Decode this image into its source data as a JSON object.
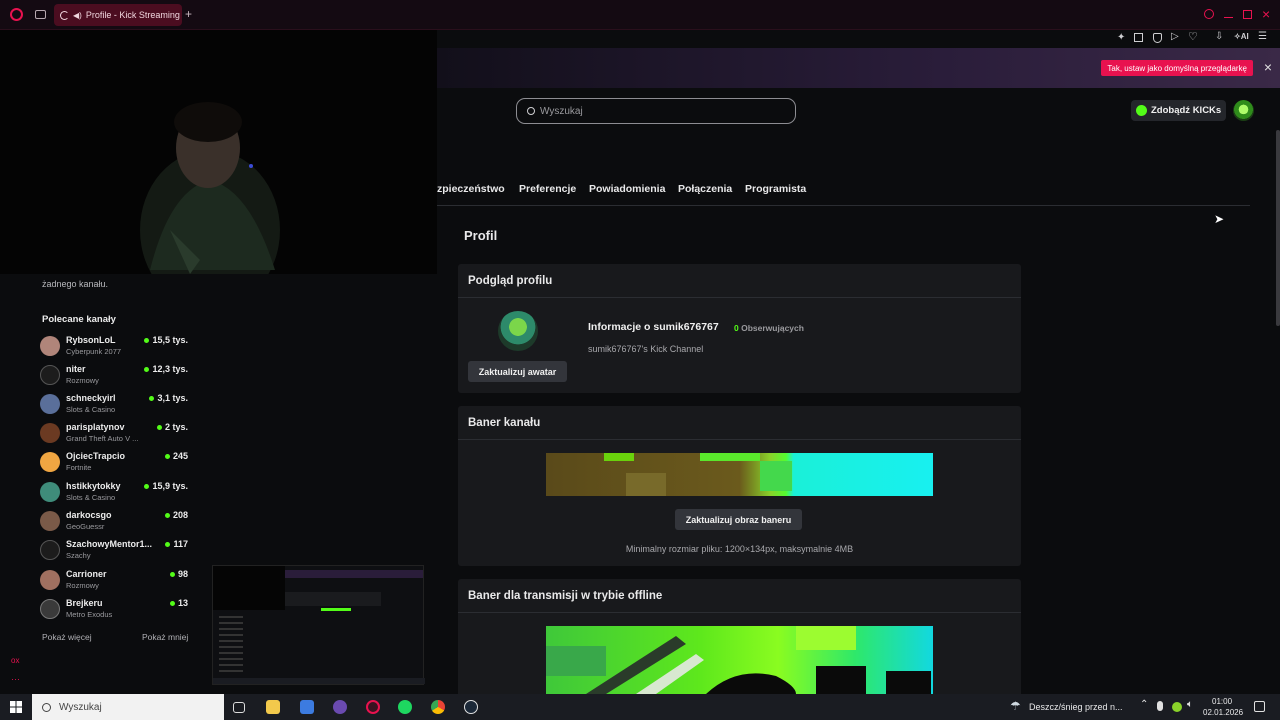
{
  "browser": {
    "tab_title": "Profile - Kick Streaming",
    "new_tab": "+",
    "default_browser_prompt": "Tak, ustaw jako domyślną przeglądarkę",
    "close": "×",
    "ai_label": "AI"
  },
  "sidebar": {
    "no_channel_text": "żadnego kanału.",
    "recommended_title": "Polecane kanały",
    "channels": [
      {
        "name": "RybsonLoL",
        "category": "Cyberpunk 2077",
        "viewers": "15,5 tys."
      },
      {
        "name": "niter",
        "category": "Rozmowy",
        "viewers": "12,3 tys."
      },
      {
        "name": "schneckyirl",
        "category": "Slots & Casino",
        "viewers": "3,1 tys."
      },
      {
        "name": "parisplatynov",
        "category": "Grand Theft Auto V ...",
        "viewers": "2 tys."
      },
      {
        "name": "OjciecTrapcio",
        "category": "Fortnite",
        "viewers": "245"
      },
      {
        "name": "hstikkytokky",
        "category": "Slots & Casino",
        "viewers": "15,9 tys."
      },
      {
        "name": "darkocsgo",
        "category": "GeoGuessr",
        "viewers": "208"
      },
      {
        "name": "SzachowyMentor1...",
        "category": "Szachy",
        "viewers": "117"
      },
      {
        "name": "Carrioner",
        "category": "Rozmowy",
        "viewers": "98"
      },
      {
        "name": "Brejkeru",
        "category": "Metro Exodus",
        "viewers": "13"
      }
    ],
    "show_more": "Pokaż więcej",
    "show_less": "Pokaż mniej"
  },
  "header": {
    "search_placeholder": "Wyszukaj",
    "kicks_button": "Zdobądź KICKs"
  },
  "settings_tabs": [
    "zpieczeństwo",
    "Preferencje",
    "Powiadomienia",
    "Połączenia",
    "Programista"
  ],
  "page_title": "Profil",
  "profile_preview": {
    "title": "Podgląd profilu",
    "info_title": "Informacje o sumik676767",
    "followers_count": "0",
    "followers_label": "Obserwujących",
    "channel_desc": "sumik676767's Kick Channel",
    "update_avatar": "Zaktualizuj awatar"
  },
  "channel_banner": {
    "title": "Baner kanału",
    "update_button": "Zaktualizuj obraz baneru",
    "hint": "Minimalny rozmiar pliku: 1200×134px, maksymalnie 4MB"
  },
  "offline_banner": {
    "title": "Baner dla transmisji w trybie offline"
  },
  "taskbar": {
    "search": "Wyszukaj",
    "weather": "Deszcz/śnieg przed n...",
    "time": "01:00",
    "date": "02.01.2026"
  },
  "colors": {
    "accent": "#53fc18",
    "brand_pink": "#e8124f"
  }
}
